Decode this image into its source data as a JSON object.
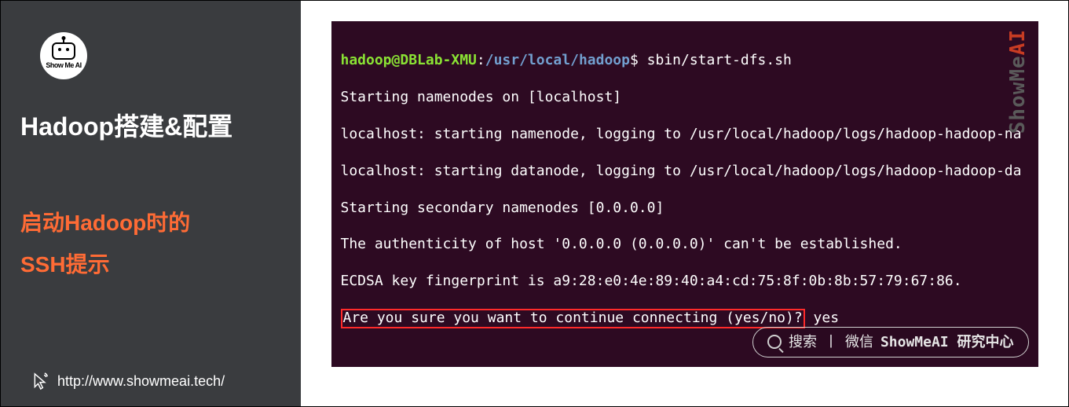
{
  "sidebar": {
    "logo_text": "Show Me AI",
    "heading": "Hadoop搭建&配置",
    "subheading_line1": "启动Hadoop时的",
    "subheading_line2": "SSH提示",
    "url": "http://www.showmeai.tech/"
  },
  "terminal": {
    "prompt_user": "hadoop@DBLab-XMU",
    "prompt_path": "/usr/local/hadoop",
    "command": "sbin/start-dfs.sh",
    "lines": [
      "Starting namenodes on [localhost]",
      "localhost: starting namenode, logging to /usr/local/hadoop/logs/hadoop-hadoop-na",
      "localhost: starting datanode, logging to /usr/local/hadoop/logs/hadoop-hadoop-da",
      "Starting secondary namenodes [0.0.0.0]",
      "The authenticity of host '0.0.0.0 (0.0.0.0)' can't be established.",
      "ECDSA key fingerprint is a9:28:e0:4e:89:40:a4:cd:75:8f:0b:8b:57:79:67:86."
    ],
    "highlighted": "Are you sure you want to continue connecting (yes/no)?",
    "response": " yes"
  },
  "watermark": {
    "part1": "ShowMe",
    "part2": "AI"
  },
  "search_badge": {
    "label1": "搜索",
    "sep": "丨",
    "label2": "微信",
    "bold": "ShowMeAI 研究中心"
  }
}
